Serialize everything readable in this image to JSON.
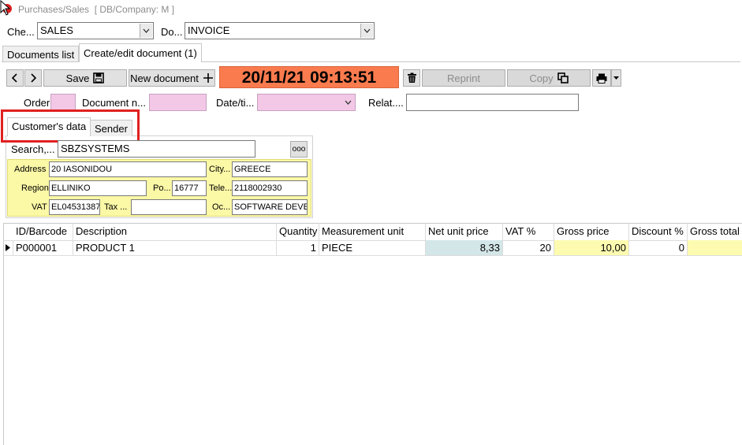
{
  "window": {
    "title": "Purchases/Sales",
    "subtitle": "[ DB/Company: M ]"
  },
  "top": {
    "che_label": "Che...",
    "che_value": "SALES",
    "do_label": "Do...",
    "do_value": "INVOICE"
  },
  "tabs": {
    "documents_list": "Documents list",
    "create_edit": "Create/edit document (1)"
  },
  "toolbar": {
    "save_label": "Save",
    "new_document_label": "New document",
    "datetime": "20/11/21 09:13:51",
    "reprint_label": "Reprint",
    "copy_label": "Copy"
  },
  "header_fields": {
    "order_label": "Order",
    "document_label": "Document n...",
    "datetime_label": "Date/ti...",
    "related_label": "Relat...."
  },
  "subtabs": {
    "customer": "Customer's data",
    "sender": "Sender"
  },
  "customer": {
    "search_label": "Search,...",
    "search_value": "SBZSYSTEMS",
    "more_label": "ooo",
    "address_label": "Address",
    "address_value": "20 IASONIDOU",
    "city_label": "City...",
    "city_value": "GREECE",
    "region_label": "Region",
    "region_value": "ELLINIKO",
    "postal_label": "Po...",
    "postal_value": "16777",
    "phone_label": "Tele...",
    "phone_value": "2118002930",
    "vat_label": "VAT",
    "vat_value": "EL04531387",
    "tax_label": "Tax ...",
    "tax_value": "",
    "occupation_label": "Oc...",
    "occupation_value": "SOFTWARE DEVEL"
  },
  "grid": {
    "columns": [
      "ID/Barcode",
      "Description",
      "Quantity",
      "Measurement unit",
      "Net unit price",
      "VAT %",
      "Gross price",
      "Discount %",
      "Gross total"
    ],
    "rows": [
      {
        "id": "P000001",
        "description": "PRODUCT 1",
        "quantity": "1",
        "unit": "PIECE",
        "net_price": "8,33",
        "vat": "20",
        "gross_price": "10,00",
        "discount": "0",
        "gross_total": ""
      }
    ]
  },
  "colors": {
    "datetime_bg": "#fa7b4e",
    "highlight_border": "#e02020",
    "pink_field": "#f2c8e6",
    "yellow_panel": "#fbf8a6",
    "net_price_bg": "#d3e6e8",
    "gross_bg": "#fdfbb0"
  }
}
